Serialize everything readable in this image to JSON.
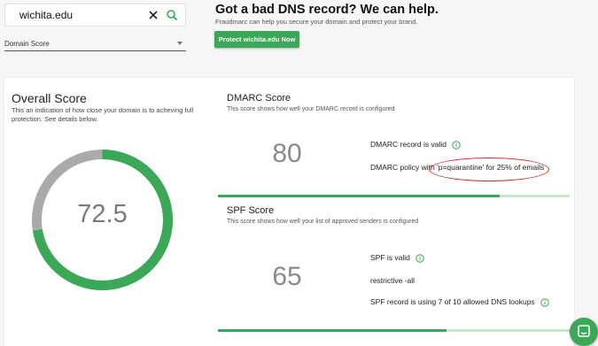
{
  "search": {
    "value": "wichita.edu"
  },
  "dropdown": {
    "selected": "Domain Score"
  },
  "promo": {
    "title": "Got a bad DNS record? We can help.",
    "subtitle": "Fraudmarc can help you secure your domain and protect your brand.",
    "button": "Protect wichita.edu Now"
  },
  "overall": {
    "title": "Overall Score",
    "description": "This an indication of how close your domain is to acheving full protection. See details below.",
    "score": "72.5",
    "score_fraction": 0.725
  },
  "dmarc": {
    "title": "DMARC Score",
    "description": "This score shows how well your DMARC record is configured",
    "score": "80",
    "score_fraction": 0.8,
    "lines": [
      "DMARC record is valid",
      "DMARC policy with 'p=quarantine' for 25% of emails"
    ]
  },
  "spf": {
    "title": "SPF Score",
    "description": "This score shows how well your list of approved senders is configured",
    "score": "65",
    "score_fraction": 0.65,
    "lines": [
      "SPF is valid",
      "restrictive -all",
      "SPF record is using 7 of 10 allowed DNS lookups"
    ]
  },
  "colors": {
    "accent": "#3aa856",
    "track": "#aaaaaa",
    "annotation": "#d32f2f"
  },
  "icons": [
    "close-icon",
    "search-icon",
    "chevron-down-icon",
    "info-icon",
    "chat-icon"
  ]
}
